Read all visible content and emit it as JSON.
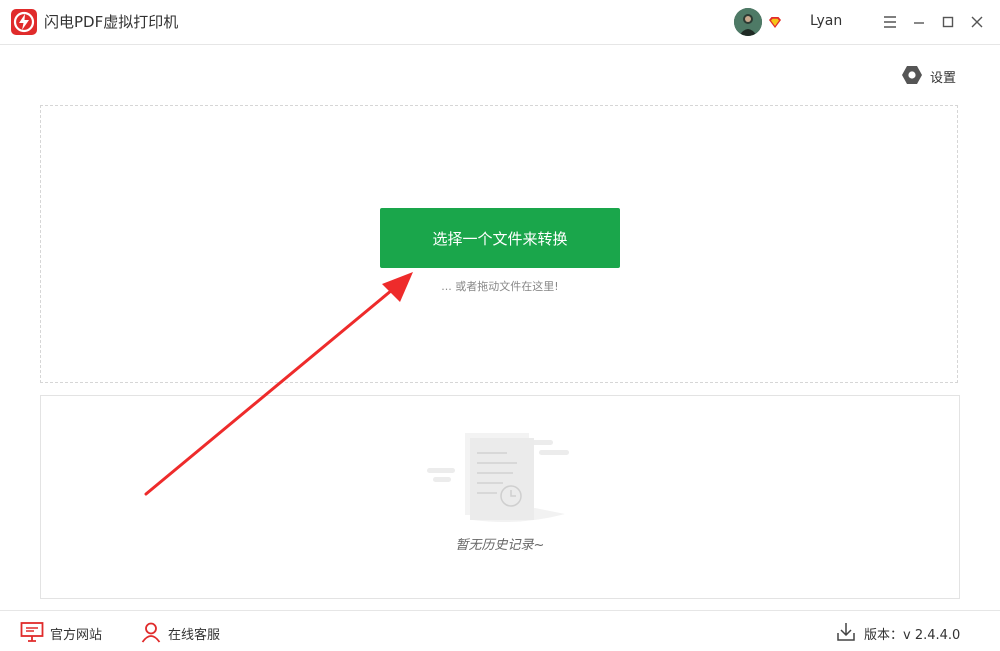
{
  "app": {
    "title": "闪电PDF虚拟打印机"
  },
  "user": {
    "name": "Lyan"
  },
  "toolbar": {
    "settings_label": "设置"
  },
  "dropzone": {
    "select_button_label": "选择一个文件来转换",
    "hint": "... 或者拖动文件在这里!"
  },
  "history": {
    "empty_text": "暂无历史记录~"
  },
  "footer": {
    "website_label": "官方网站",
    "support_label": "在线客服",
    "version_label": "版本：",
    "version_value": "v 2.4.4.0"
  },
  "colors": {
    "accent": "#1aa64b",
    "brand": "#e02b2b",
    "arrow": "#ee2b2b"
  },
  "icons": {
    "menu": "menu-icon",
    "minimize": "minimize-icon",
    "maximize": "maximize-icon",
    "close": "close-icon",
    "settings": "hexagon-settings-icon",
    "website": "monitor-icon",
    "support": "person-icon",
    "download": "download-icon"
  }
}
